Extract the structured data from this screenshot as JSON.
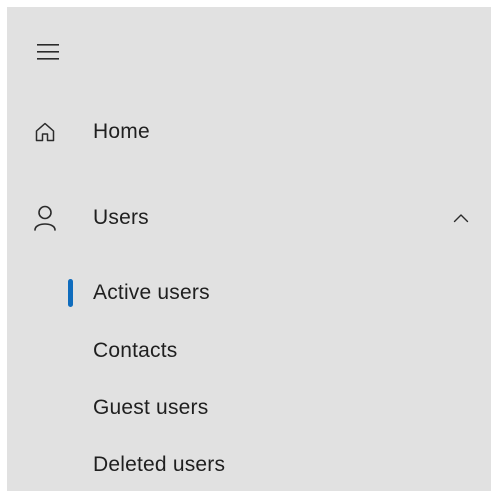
{
  "menu": {
    "toggle_icon": "hamburger-icon"
  },
  "nav": {
    "home": {
      "label": "Home",
      "icon": "home-icon"
    },
    "users": {
      "label": "Users",
      "icon": "person-icon",
      "expanded": true,
      "chevron_icon": "chevron-up-icon",
      "children": [
        {
          "label": "Active users",
          "selected": true
        },
        {
          "label": "Contacts",
          "selected": false
        },
        {
          "label": "Guest users",
          "selected": false
        },
        {
          "label": "Deleted users",
          "selected": false
        }
      ]
    }
  },
  "colors": {
    "panel_background": "#e1e1e1",
    "text": "#1f1f1f",
    "selection_indicator": "#0f6cbd"
  }
}
